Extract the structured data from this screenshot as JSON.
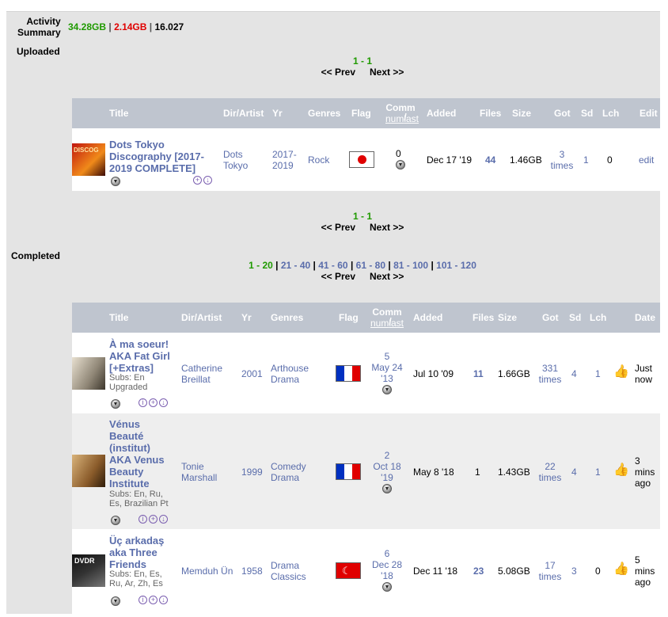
{
  "summary": {
    "label1": "Activity",
    "label2": "Summary",
    "up": "34.28GB",
    "sep1": "|",
    "down": "2.14GB",
    "sep2": "|",
    "ratio": "16.027"
  },
  "sections": {
    "uploaded": "Uploaded",
    "completed": "Completed"
  },
  "pager_up": {
    "range": "1 - 1",
    "prev": "<< Prev",
    "next": "Next >>"
  },
  "pager_comp": {
    "current": "1 - 20",
    "sep": "|",
    "p2": "21 - 40",
    "p3": "41 - 60",
    "p4": "61 - 80",
    "p5": "81 - 100",
    "p6": "101 - 120",
    "prev": "<< Prev",
    "next": "Next >>"
  },
  "headers_up": {
    "title": "Title",
    "dir": "Dir/Artist",
    "yr": "Yr",
    "genres": "Genres",
    "flag": "Flag",
    "comm": "Comm",
    "num": "num",
    "slash": "/",
    "last": "last",
    "added": "Added",
    "files": "Files",
    "size": "Size",
    "got": "Got",
    "sd": "Sd",
    "lch": "Lch",
    "edit": "Edit"
  },
  "headers_comp": {
    "title": "Title",
    "dir": "Dir/Artist",
    "yr": "Yr",
    "genres": "Genres",
    "flag": "Flag",
    "comm": "Comm",
    "num": "num",
    "slash": "/",
    "last": "last",
    "added": "Added",
    "files": "Files",
    "size": "Size",
    "got": "Got",
    "sd": "Sd",
    "lch": "Lch",
    "date": "Date"
  },
  "uploaded_row": {
    "title1": "Dots Tokyo",
    "title2": "Discography [2017-",
    "title3": "2019 COMPLETE]",
    "dir1": "Dots",
    "dir2": "Tokyo",
    "yr1": "2017-",
    "yr2": "2019",
    "genre": "Rock",
    "comm": "0",
    "added": "Dec 17 '19",
    "files": "44",
    "size": "1.46GB",
    "got1": "3",
    "got2": "times",
    "sd": "1",
    "lch": "0",
    "edit": "edit",
    "thumb_text": "DISCOG"
  },
  "rows": [
    {
      "t1": "À ma soeur!",
      "t2": "AKA Fat Girl",
      "t3": "[+Extras]",
      "subs1": "Subs: En",
      "subs2": "Upgraded",
      "dir1": "Catherine",
      "dir2": "Breillat",
      "yr": "2001",
      "g1": "Arthouse",
      "g2": "Drama",
      "c1": "5",
      "c2": "May 24",
      "c3": "'13",
      "added": "Jul 10 '09",
      "files": "11",
      "size": "1.66GB",
      "got1": "331",
      "got2": "times",
      "sd": "4",
      "lch": "1",
      "d1": "Just",
      "d2": "now"
    },
    {
      "t1": "Vénus",
      "t2": "Beauté",
      "t3": "(institut)",
      "t4": "AKA Venus",
      "t5": "Beauty",
      "t6": "Institute",
      "subs1": "Subs: En, Ru,",
      "subs2": "Es, Brazilian Pt",
      "dir1": "Tonie",
      "dir2": "Marshall",
      "yr": "1999",
      "g1": "Comedy",
      "g2": "Drama",
      "c1": "2",
      "c2": "Oct 18",
      "c3": "'19",
      "added": "May 8 '18",
      "files": "1",
      "size": "1.43GB",
      "got1": "22",
      "got2": "times",
      "sd": "4",
      "lch": "1",
      "d1": "3",
      "d2": "mins",
      "d3": "ago"
    },
    {
      "t1": "Üç arkadaş",
      "t2": "aka Three",
      "t3": "Friends",
      "subs1": "Subs: En, Es,",
      "subs2": "Ru, Ar, Zh, Es",
      "dir1": "Memduh Ün",
      "yr": "1958",
      "g1": "Drama",
      "g2": "Classics",
      "c1": "6",
      "c2": "Dec 28",
      "c3": "'18",
      "added": "Dec 11 '18",
      "files": "23",
      "size": "5.08GB",
      "got1": "17",
      "got2": "times",
      "sd": "3",
      "lch": "0",
      "d1": "5",
      "d2": "mins",
      "d3": "ago",
      "thumb_text": "DVDR"
    }
  ],
  "colors": {
    "header_bg": "#bfc5cf",
    "link": "#5a6dab",
    "green": "#1f9a00",
    "red": "#e00000"
  }
}
